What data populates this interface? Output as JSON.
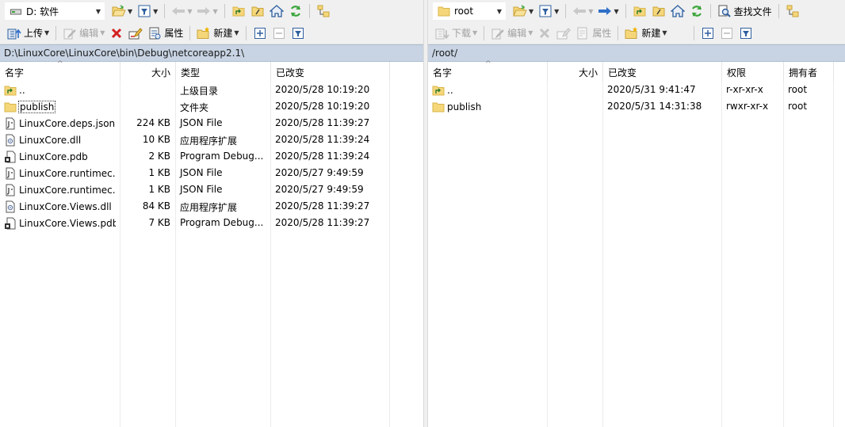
{
  "left": {
    "drive": "D: 软件",
    "toolbar2": {
      "upload": "上传",
      "edit": "编辑",
      "properties": "属性",
      "new": "新建"
    },
    "path": "D:\\LinuxCore\\LinuxCore\\bin\\Debug\\netcoreapp2.1\\",
    "columns": {
      "name": "名字",
      "size": "大小",
      "type": "类型",
      "modified": "已改变"
    },
    "rows": [
      {
        "icon": "parent-dir-icon",
        "name": "..",
        "size": "",
        "type": "上级目录",
        "modified": "2020/5/28   10:19:20"
      },
      {
        "icon": "folder-icon",
        "name": "publish",
        "size": "",
        "type": "文件夹",
        "modified": "2020/5/28   10:19:20"
      },
      {
        "icon": "json-file-icon",
        "name": "LinuxCore.deps.json",
        "size": "224 KB",
        "type": "JSON File",
        "modified": "2020/5/28   11:39:27"
      },
      {
        "icon": "dll-file-icon",
        "name": "LinuxCore.dll",
        "size": "10 KB",
        "type": "应用程序扩展",
        "modified": "2020/5/28   11:39:24"
      },
      {
        "icon": "pdb-file-icon",
        "name": "LinuxCore.pdb",
        "size": "2 KB",
        "type": "Program Debug...",
        "modified": "2020/5/28   11:39:24"
      },
      {
        "icon": "json-file-icon",
        "name": "LinuxCore.runtimec...",
        "size": "1 KB",
        "type": "JSON File",
        "modified": "2020/5/27    9:49:59"
      },
      {
        "icon": "json-file-icon",
        "name": "LinuxCore.runtimec...",
        "size": "1 KB",
        "type": "JSON File",
        "modified": "2020/5/27    9:49:59"
      },
      {
        "icon": "dll-file-icon",
        "name": "LinuxCore.Views.dll",
        "size": "84 KB",
        "type": "应用程序扩展",
        "modified": "2020/5/28   11:39:27"
      },
      {
        "icon": "pdb-file-icon",
        "name": "LinuxCore.Views.pdb",
        "size": "7 KB",
        "type": "Program Debug...",
        "modified": "2020/5/28   11:39:27"
      }
    ]
  },
  "right": {
    "drive": "root",
    "find_files": "查找文件",
    "toolbar2": {
      "download": "下载",
      "edit": "编辑",
      "properties": "属性",
      "new": "新建"
    },
    "path": "/root/",
    "columns": {
      "name": "名字",
      "size": "大小",
      "modified": "已改变",
      "permissions": "权限",
      "owner": "拥有者"
    },
    "rows": [
      {
        "icon": "parent-dir-icon",
        "name": "..",
        "size": "",
        "modified": "2020/5/31 9:41:47",
        "permissions": "r-xr-xr-x",
        "owner": "root"
      },
      {
        "icon": "folder-icon",
        "name": "publish",
        "size": "",
        "modified": "2020/5/31 14:31:38",
        "permissions": "rwxr-xr-x",
        "owner": "root"
      }
    ]
  },
  "colors": {
    "pathbar": "#c8d4e3",
    "folder": "#f5d77a",
    "accent_green": "#3aa53a",
    "delete_red": "#d42020",
    "arrow_blue": "#2f6fc9"
  }
}
